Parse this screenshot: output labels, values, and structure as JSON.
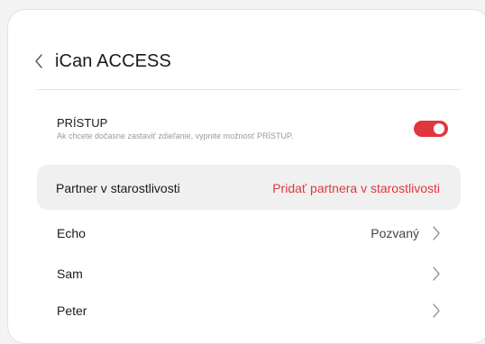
{
  "header": {
    "title": "iCan ACCESS"
  },
  "access": {
    "title": "PRÍSTUP",
    "description": "Ak chcete dočasne zastaviť zdieľanie, vypnite možnosť PRÍSTUP.",
    "enabled": true
  },
  "partner": {
    "label": "Partner v starostlivosti",
    "add_link": "Pridať partnera v starostlivosti"
  },
  "people": [
    {
      "name": "Echo",
      "status": "Pozvaný"
    },
    {
      "name": "Sam",
      "status": ""
    },
    {
      "name": "Peter",
      "status": ""
    }
  ],
  "colors": {
    "accent": "#e0373f",
    "background": "#ffffff",
    "highlight_row": "#f0f0f0"
  },
  "icons": {
    "back": "chevron-left-icon",
    "row": "chevron-right-icon"
  }
}
